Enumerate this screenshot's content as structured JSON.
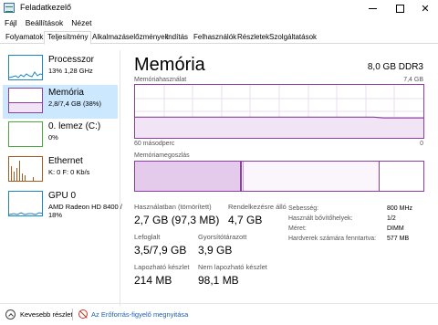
{
  "window": {
    "title": "Feladatkezelő"
  },
  "menu": {
    "file": "Fájl",
    "options": "Beállítások",
    "view": "Nézet"
  },
  "tabs": [
    "Folyamatok",
    "Teljesítmény",
    "Alkalmazáselőzmények",
    "Indítás",
    "Felhasználók",
    "Részletek",
    "Szolgáltatások"
  ],
  "sidebar": [
    {
      "name": "Processzor",
      "line1": "13% 1,28 GHz",
      "line2": ""
    },
    {
      "name": "Memória",
      "line1": "2,8/7,4 GB (38%)",
      "line2": ""
    },
    {
      "name": "0. lemez (C:)",
      "line1": "0%",
      "line2": ""
    },
    {
      "name": "Ethernet",
      "line1": "K: 0 F: 0 Kb/s",
      "line2": ""
    },
    {
      "name": "GPU 0",
      "line1": "AMD Radeon HD 8400 /",
      "line2": "18%"
    }
  ],
  "main": {
    "title": "Memória",
    "capacity": "8,0 GB DDR3",
    "usage_label": "Memóriahasználat",
    "usage_max": "7,4 GB",
    "axis_left": "60 másodperc",
    "axis_right": "0",
    "composition_label": "Memóriamegoszlás"
  },
  "stats": {
    "in_use_label": "Használatban (tömörített)",
    "in_use_value": "2,7 GB (97,3 MB)",
    "available_label": "Rendelkezésre álló",
    "available_value": "4,7 GB",
    "committed_label": "Lefoglalt",
    "committed_value": "3,5/7,9 GB",
    "cached_label": "Gyorsítótárazott",
    "cached_value": "3,9 GB",
    "paged_label": "Lapozható készlet",
    "paged_value": "214 MB",
    "nonpaged_label": "Nem lapozható készlet",
    "nonpaged_value": "98,1 MB"
  },
  "specs": [
    {
      "label": "Sebesség:",
      "value": "800 MHz"
    },
    {
      "label": "Használt bővítőhelyek:",
      "value": "1/2"
    },
    {
      "label": "Méret:",
      "value": "DIMM"
    },
    {
      "label": "Hardverek számára fenntartva:",
      "value": "577 MB"
    }
  ],
  "footer": {
    "fewer_details": "Kevesebb részlet",
    "resource_monitor": "Az Erőforrás-figyelő megnyitása"
  },
  "chart_data": {
    "type": "area",
    "ylim": [
      0,
      7.4
    ],
    "memory_usage_gb": [
      2.9,
      2.9,
      2.9,
      2.9,
      2.9,
      2.9,
      2.9,
      2.9,
      2.9,
      2.9,
      2.9,
      2.9,
      2.9,
      2.9,
      2.9,
      2.9,
      2.9,
      2.9,
      2.9,
      2.9,
      2.9,
      2.9,
      2.9,
      2.9,
      2.9,
      2.8,
      2.8,
      2.8,
      2.8,
      2.8
    ]
  },
  "colors": {
    "accent": "#8b3fa0",
    "fill": "#f1e4f5",
    "selected": "#cce8ff",
    "cpu": "#1a84c7",
    "disk": "#4aa83d",
    "ethernet": "#a65a1e",
    "gpu": "#1a84c7"
  }
}
